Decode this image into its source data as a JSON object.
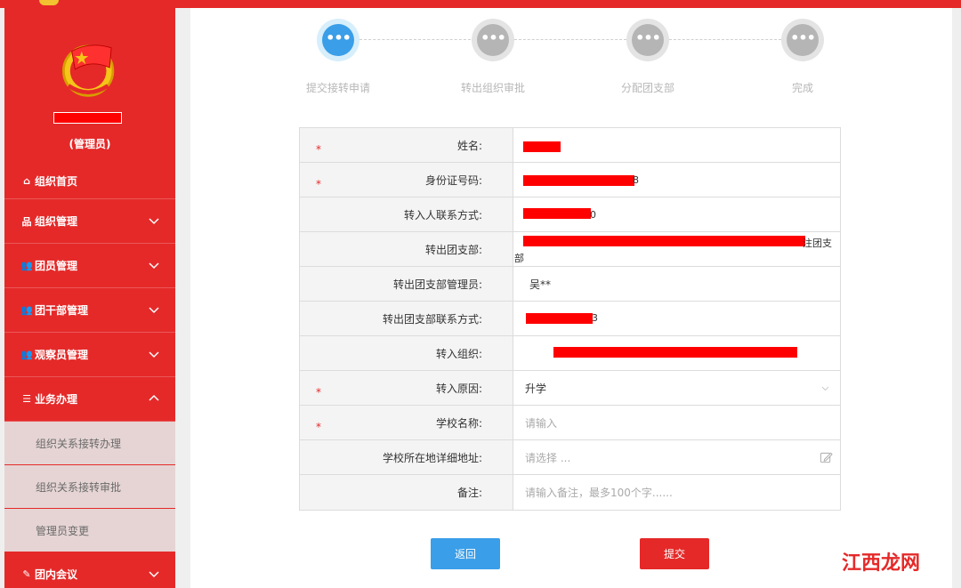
{
  "sidebar": {
    "role": "(管理员)",
    "menu": [
      {
        "label": "组织首页",
        "icon": "home-icon"
      },
      {
        "label": "组织管理",
        "icon": "sitemap-icon"
      },
      {
        "label": "团员管理",
        "icon": "users-icon"
      },
      {
        "label": "团干部管理",
        "icon": "users-icon"
      },
      {
        "label": "观察员管理",
        "icon": "users-icon"
      },
      {
        "label": "业务办理",
        "icon": "list-icon"
      }
    ],
    "submenu": [
      "组织关系接转办理",
      "组织关系接转审批",
      "管理员变更"
    ],
    "last_menu": {
      "label": "团内会议",
      "icon": "edit-icon"
    }
  },
  "steps": [
    "提交接转申请",
    "转出组织审批",
    "分配团支部",
    "完成"
  ],
  "form": {
    "name_label": "姓名:",
    "id_label": "身份证号码:",
    "id_tail": "8",
    "contact_label": "转入人联系方式:",
    "contact_tail": "0",
    "from_branch_label": "转出团支部:",
    "from_branch_tail": "注团支",
    "from_branch_wrap": "部",
    "from_admin_label": "转出团支部管理员:",
    "from_admin_value": "吴**",
    "from_contact_label": "转出团支部联系方式:",
    "from_contact_tail": "3",
    "to_org_label": "转入组织:",
    "reason_label": "转入原因:",
    "reason_value": "升学",
    "school_label": "学校名称:",
    "school_placeholder": "请输入",
    "address_label": "学校所在地详细地址:",
    "address_placeholder": "请选择 ...",
    "note_label": "备注:",
    "note_placeholder": "请输入备注，最多100个字......"
  },
  "buttons": {
    "back": "返回",
    "submit": "提交"
  },
  "watermark": "江西龙网",
  "colors": {
    "primary_red": "#e52929",
    "blue": "#3a9ee8",
    "redaction": "#ff0000"
  }
}
